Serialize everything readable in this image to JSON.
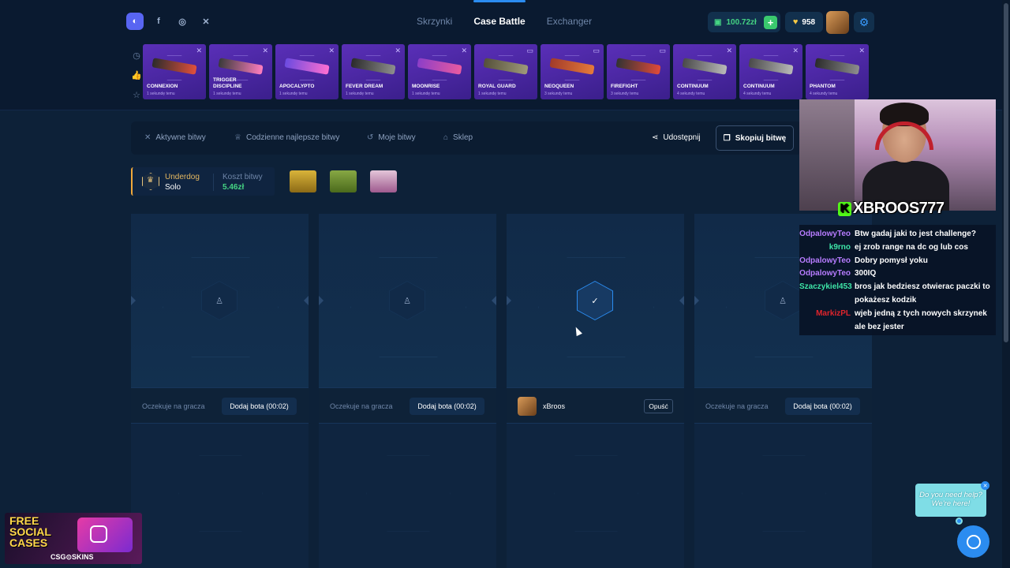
{
  "header": {
    "social_icons": [
      "discord-icon",
      "facebook-icon",
      "instagram-icon",
      "x-icon"
    ],
    "nav": [
      {
        "label": "Skrzynki",
        "active": false
      },
      {
        "label": "Case Battle",
        "active": true
      },
      {
        "label": "Exchanger",
        "active": false
      }
    ],
    "balance": "100.72zł",
    "coins": "958"
  },
  "live_drops": [
    {
      "name": "CONNEXION",
      "time": "1 sekundę temu"
    },
    {
      "name": "TRIGGER DISCIPLINE",
      "time": "1 sekundę temu"
    },
    {
      "name": "APOCALYPTO",
      "time": "1 sekundę temu"
    },
    {
      "name": "FEVER DREAM",
      "time": "1 sekundę temu"
    },
    {
      "name": "MOONRISE",
      "time": "1 sekundę temu"
    },
    {
      "name": "ROYAL GUARD",
      "time": "1 sekundę temu"
    },
    {
      "name": "NEOQUEEN",
      "time": "3 sekundy temu"
    },
    {
      "name": "FIREFIGHT",
      "time": "3 sekundy temu"
    },
    {
      "name": "CONTINUUM",
      "time": "4 sekundy temu"
    },
    {
      "name": "CONTINUUM",
      "time": "4 sekundy temu"
    },
    {
      "name": "PHANTOM",
      "time": "4 sekundy temu"
    }
  ],
  "tabs": {
    "active_battles": "Aktywne bitwy",
    "daily_best": "Codzienne najlepsze bitwy",
    "my_battles": "Moje bitwy",
    "shop": "Sklep",
    "share": "Udostępnij",
    "copy": "Skopiuj bitwę"
  },
  "battle_info": {
    "mode_label": "Underdog",
    "mode_value": "Solo",
    "cost_label": "Koszt bitwy",
    "cost_value": "5.46zł"
  },
  "slots": [
    {
      "waiting": "Oczekuje na gracza",
      "bot_button": "Dodaj bota (00:02)"
    },
    {
      "waiting": "Oczekuje na gracza",
      "bot_button": "Dodaj bota (00:02)"
    },
    {
      "player": "xBroos",
      "leave": "Opuść"
    },
    {
      "waiting": "Oczekuje na gracza",
      "bot_button": "Dodaj bota (00:02)"
    }
  ],
  "stream": {
    "streamer": "XBROOS777",
    "chat": [
      {
        "user": "OdpalowyTeo",
        "color": "#b77cff",
        "text": "Btw gadaj jaki to jest challenge?"
      },
      {
        "user": "k9rno",
        "color": "#3ee6a8",
        "text": "ej zrob range na dc og lub cos"
      },
      {
        "user": "OdpalowyTeo",
        "color": "#b77cff",
        "text": "Dobry pomysł yoku"
      },
      {
        "user": "OdpalowyTeo",
        "color": "#b77cff",
        "text": "300IQ"
      },
      {
        "user": "Szaczykiel453",
        "color": "#3ee6a8",
        "text": "bros jak bedziesz otwierac paczki to pokażesz kodzik"
      },
      {
        "user": "MarkizPL",
        "color": "#e0242c",
        "text": "wjeb jedną z tych nowych skrzynek ale bez jester"
      }
    ]
  },
  "promo": {
    "line1": "FREE",
    "line2": "SOCIAL",
    "line3": "CASES",
    "brand": "CSG⊙SKINS"
  },
  "help": {
    "line1": "Do you need help?",
    "line2": "We're here!"
  }
}
